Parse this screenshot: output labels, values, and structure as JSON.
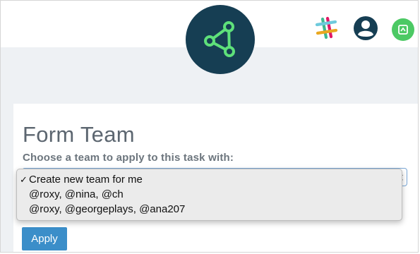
{
  "form": {
    "title": "Form Team",
    "prompt": "Choose a team to apply to this task with:",
    "apply_label": "Apply"
  },
  "team_select": {
    "selected_index": 0,
    "options": [
      {
        "label": "Create new team for me",
        "selected": true
      },
      {
        "label": "@roxy, @nina, @ch",
        "selected": false
      },
      {
        "label": "@roxy, @georgeplays, @ana207",
        "selected": false
      }
    ]
  },
  "icons": {
    "logo": "share-graph-icon",
    "slack": "slack-icon",
    "account": "account-icon",
    "app": "app-icon"
  },
  "colors": {
    "logo_bg": "#163e53",
    "logo_fg": "#5ee07a",
    "apply_bg": "#3b8ec9",
    "app_icon_bg": "#4cc964",
    "title_text": "#5c6670",
    "page_bg": "#eef1f4"
  }
}
